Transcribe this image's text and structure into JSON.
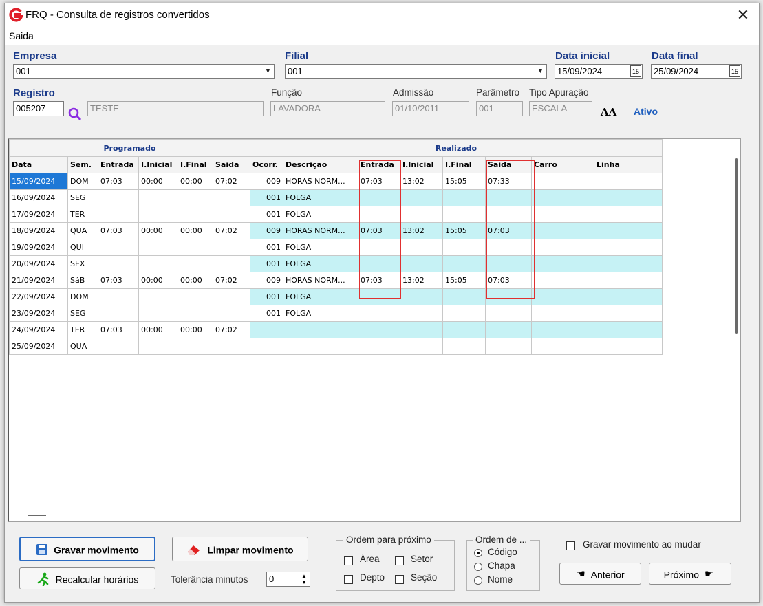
{
  "window": {
    "title": "FRQ - Consulta de registros convertidos",
    "close": "✕"
  },
  "menu": {
    "items": [
      "Saida"
    ]
  },
  "header": {
    "empresa_label": "Empresa",
    "empresa_value": "001",
    "filial_label": "Filial",
    "filial_value": "001",
    "data_inicial_label": "Data inicial",
    "data_inicial_value": "15/09/2024",
    "data_final_label": "Data final",
    "data_final_value": "25/09/2024",
    "registro_label": "Registro",
    "registro_value": "005207",
    "nome_value": "TESTE",
    "funcao_label": "Função",
    "funcao_value": "LAVADORA",
    "admissao_label": "Admissão",
    "admissao_value": "01/10/2011",
    "parametro_label": "Parâmetro",
    "parametro_value": "001",
    "tipo_label": "Tipo Apuração",
    "tipo_value": "ESCALA",
    "aa_icon": "AA",
    "status": "Ativo",
    "cal_glyph": "15"
  },
  "grid": {
    "group_programado": "Programado",
    "group_realizado": "Realizado",
    "columns": [
      "Data",
      "Sem.",
      "Entrada",
      "I.Inicial",
      "I.Final",
      "Saida",
      "Ocorr.",
      "Descrição",
      "Entrada",
      "I.Inicial",
      "I.Final",
      "Saida",
      "Carro",
      "Linha"
    ],
    "rows": [
      {
        "c": [
          "15/09/2024",
          "DOM",
          "07:03",
          "00:00",
          "00:00",
          "07:02",
          "009",
          "HORAS NORM...",
          "07:03",
          "13:02",
          "15:05",
          "07:33",
          "",
          ""
        ],
        "cyan": false
      },
      {
        "c": [
          "16/09/2024",
          "SEG",
          "",
          "",
          "",
          "",
          "001",
          "FOLGA",
          "",
          "",
          "",
          "",
          "",
          ""
        ],
        "cyan": true
      },
      {
        "c": [
          "17/09/2024",
          "TER",
          "",
          "",
          "",
          "",
          "001",
          "FOLGA",
          "",
          "",
          "",
          "",
          "",
          ""
        ],
        "cyan": false
      },
      {
        "c": [
          "18/09/2024",
          "QUA",
          "07:03",
          "00:00",
          "00:00",
          "07:02",
          "009",
          "HORAS NORM...",
          "07:03",
          "13:02",
          "15:05",
          "07:03",
          "",
          ""
        ],
        "cyan": true
      },
      {
        "c": [
          "19/09/2024",
          "QUI",
          "",
          "",
          "",
          "",
          "001",
          "FOLGA",
          "",
          "",
          "",
          "",
          "",
          ""
        ],
        "cyan": false
      },
      {
        "c": [
          "20/09/2024",
          "SEX",
          "",
          "",
          "",
          "",
          "001",
          "FOLGA",
          "",
          "",
          "",
          "",
          "",
          ""
        ],
        "cyan": true
      },
      {
        "c": [
          "21/09/2024",
          "SáB",
          "07:03",
          "00:00",
          "00:00",
          "07:02",
          "009",
          "HORAS NORM...",
          "07:03",
          "13:02",
          "15:05",
          "07:03",
          "",
          ""
        ],
        "cyan": false
      },
      {
        "c": [
          "22/09/2024",
          "DOM",
          "",
          "",
          "",
          "",
          "001",
          "FOLGA",
          "",
          "",
          "",
          "",
          "",
          ""
        ],
        "cyan": true
      },
      {
        "c": [
          "23/09/2024",
          "SEG",
          "",
          "",
          "",
          "",
          "001",
          "FOLGA",
          "",
          "",
          "",
          "",
          "",
          ""
        ],
        "cyan": false
      },
      {
        "c": [
          "24/09/2024",
          "TER",
          "07:03",
          "00:00",
          "00:00",
          "07:02",
          "",
          "",
          "",
          "",
          "",
          "",
          "",
          ""
        ],
        "cyan": true
      },
      {
        "c": [
          "25/09/2024",
          "QUA",
          "",
          "",
          "",
          "",
          "",
          "",
          "",
          "",
          "",
          "",
          "",
          ""
        ],
        "cyan": false
      }
    ],
    "colors": {
      "cyan_row": "#c6f2f5",
      "selected_cell": "#1e78d6",
      "highlight_box": "#e03030"
    }
  },
  "footer": {
    "gravar_label": "Gravar movimento",
    "limpar_label": "Limpar movimento",
    "recalcular_label": "Recalcular horários",
    "tolerancia_label": "Tolerância minutos",
    "tolerancia_value": "0",
    "ordem_proximo_title": "Ordem para próximo",
    "ordem_proximo_options": [
      "Área",
      "Setor",
      "Depto",
      "Seção"
    ],
    "ordem_de_title": "Ordem de ...",
    "ordem_de_options": [
      "Código",
      "Chapa",
      "Nome"
    ],
    "ordem_de_selected": "Código",
    "gravar_ao_mudar_label": "Gravar movimento ao mudar",
    "anterior_label": "Anterior",
    "proximo_label": "Próximo",
    "icons": [
      "floppy-disk-icon",
      "eraser-icon",
      "running-man-icon",
      "pointing-hand-left-icon",
      "pointing-hand-right-icon",
      "search-icon"
    ]
  }
}
